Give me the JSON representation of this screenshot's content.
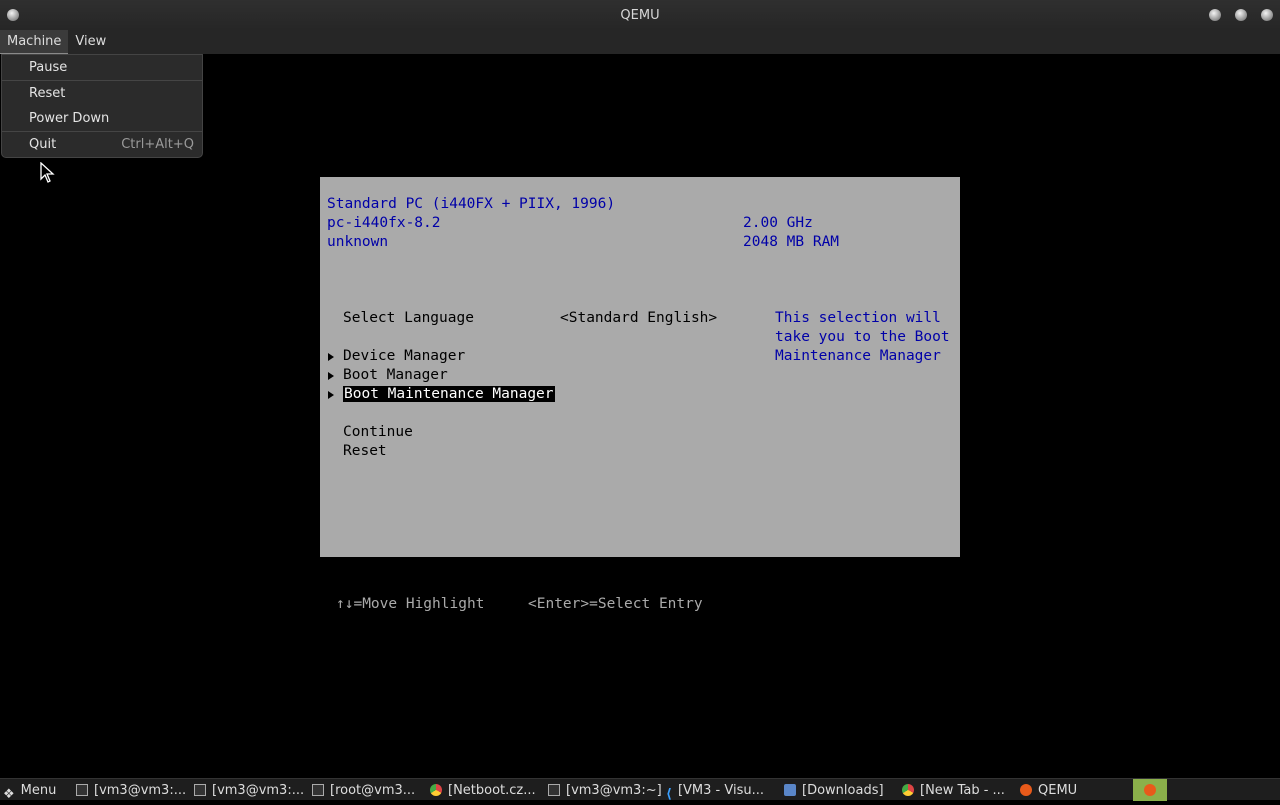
{
  "window": {
    "title": "QEMU"
  },
  "menubar": {
    "items": [
      {
        "label": "Machine"
      },
      {
        "label": "View"
      }
    ]
  },
  "machine_menu": {
    "items": [
      {
        "label": "Pause",
        "accel": ""
      },
      {
        "label": "Reset",
        "accel": ""
      },
      {
        "label": "Power Down",
        "accel": ""
      },
      {
        "label": "Quit",
        "accel": "Ctrl+Alt+Q"
      }
    ]
  },
  "bios": {
    "system_name": "Standard PC (i440FX + PIIX, 1996)",
    "machine": "pc-i440fx-8.2",
    "version": "unknown",
    "cpu_speed": "2.00 GHz",
    "ram": "2048 MB RAM",
    "language_label": "Select Language",
    "language_value": "<Standard English>",
    "help_lines": [
      "This selection will",
      "take you to the Boot",
      "Maintenance Manager"
    ],
    "menu_items": [
      {
        "label": "Device Manager"
      },
      {
        "label": "Boot Manager"
      },
      {
        "label": "Boot Maintenance Manager"
      }
    ],
    "continue": "Continue",
    "reset": "Reset",
    "hint_move": "↑↓=Move Highlight",
    "hint_enter": "<Enter>=Select Entry"
  },
  "taskbar": {
    "menu_label": "Menu",
    "items": [
      {
        "label": "[vm3@vm3:...",
        "icon": "terminal-icon"
      },
      {
        "label": "[vm3@vm3:...",
        "icon": "terminal-icon"
      },
      {
        "label": "[root@vm3...",
        "icon": "terminal-icon"
      },
      {
        "label": "[Netboot.cz...",
        "icon": "chrome-icon"
      },
      {
        "label": "[vm3@vm3:~]",
        "icon": "terminal-icon"
      },
      {
        "label": "[VM3 - Visu...",
        "icon": "vscode-icon"
      },
      {
        "label": "[Downloads]",
        "icon": "folder-icon"
      },
      {
        "label": "[New Tab - ...",
        "icon": "chrome-icon"
      },
      {
        "label": "QEMU",
        "icon": "qemu-icon"
      }
    ]
  }
}
